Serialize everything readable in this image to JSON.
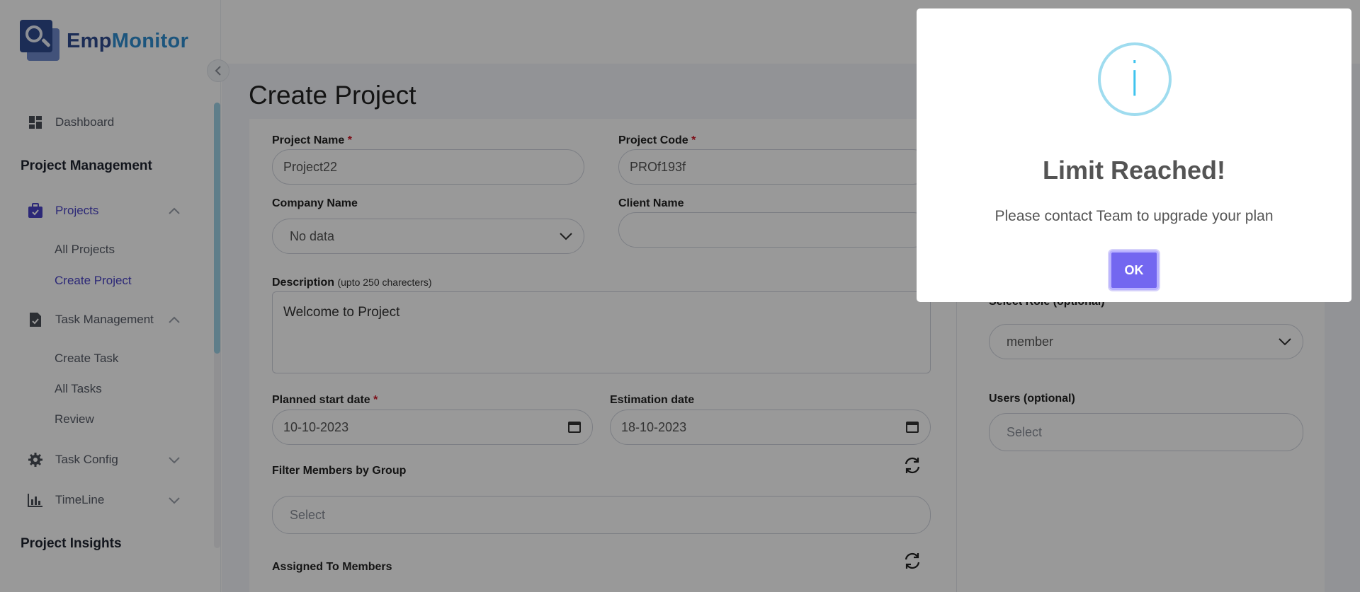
{
  "app": {
    "logo_part1": "Emp",
    "logo_part2": "Monitor"
  },
  "sidebar": {
    "dashboard": "Dashboard",
    "project_management": "Project Management",
    "projects": "Projects",
    "all_projects": "All Projects",
    "create_project": "Create Project",
    "task_management": "Task Management",
    "create_task": "Create Task",
    "all_tasks": "All Tasks",
    "review": "Review",
    "task_config": "Task Config",
    "timeline": "TimeLine",
    "project_insights": "Project Insights"
  },
  "page": {
    "title": "Create Project"
  },
  "form": {
    "project_name_label": "Project Name",
    "project_name_value": "Project22",
    "project_code_label": "Project Code",
    "project_code_value": "PROf193f",
    "company_name_label": "Company Name",
    "company_name_value": "No data",
    "client_name_label": "Client Name",
    "client_name_value": "",
    "description_label": "Description",
    "description_hint": "(upto 250 charecters)",
    "description_value": "Welcome to Project",
    "start_date_label": "Planned start date",
    "start_date_value": "10-10-2023",
    "estimation_date_label": "Estimation date",
    "estimation_date_value": "18-10-2023",
    "filter_group_label": "Filter Members by Group",
    "filter_group_placeholder": "Select",
    "assigned_members_label": "Assigned To Members",
    "select_role_label": "Select Role (optional)",
    "select_role_value": "member",
    "users_label": "Users (optional)",
    "users_placeholder": "Select",
    "required_mark": "*"
  },
  "modal": {
    "icon": "i",
    "title": "Limit Reached!",
    "message": "Please contact Team to upgrade your plan",
    "ok_label": "OK"
  },
  "colors": {
    "accent": "#7367f0",
    "info": "#3fc3ee",
    "active_nav": "#4a44c6",
    "required": "#d11a2a"
  }
}
